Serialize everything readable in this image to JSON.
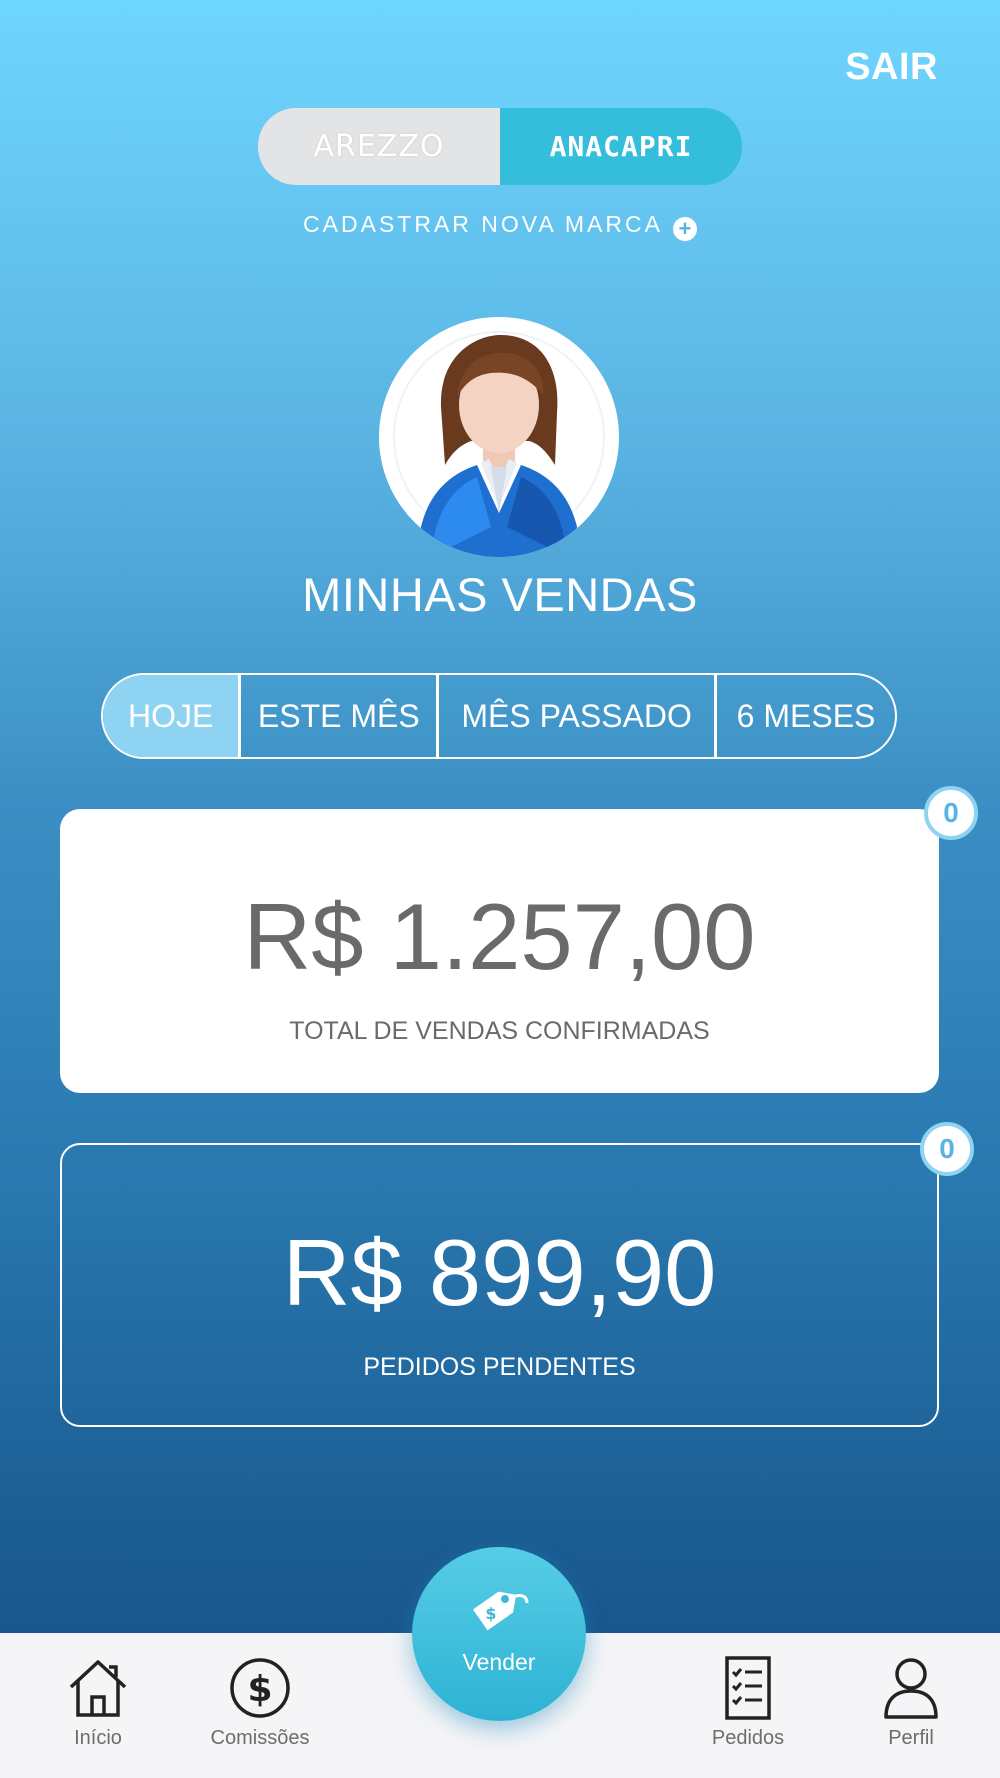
{
  "header": {
    "logout_label": "SAIR"
  },
  "brands": {
    "options": [
      {
        "label": "AREZZO",
        "active": false
      },
      {
        "label": "ANACAPRI",
        "active": true
      }
    ],
    "add_brand_label": "CADASTRAR NOVA MARCA",
    "add_brand_icon": "plus-circle-icon"
  },
  "profile": {
    "avatar_icon": "businesswoman-avatar"
  },
  "main": {
    "title": "MINHAS VENDAS",
    "period_tabs": [
      {
        "label": "HOJE",
        "selected": true
      },
      {
        "label": "ESTE MÊS",
        "selected": false
      },
      {
        "label": "MÊS PASSADO",
        "selected": false
      },
      {
        "label": "6 MESES",
        "selected": false
      }
    ],
    "confirmed": {
      "amount": "R$ 1.257,00",
      "label": "TOTAL DE VENDAS CONFIRMADAS",
      "badge": "0"
    },
    "pending": {
      "amount": "R$ 899,90",
      "label": "PEDIDOS PENDENTES",
      "badge": "0"
    }
  },
  "bottom_nav": {
    "items": [
      {
        "label": "Início",
        "icon": "home-icon"
      },
      {
        "label": "Comissões",
        "icon": "dollar-circle-icon"
      },
      {
        "label": "Vender",
        "icon": "price-tag-icon"
      },
      {
        "label": "Pedidos",
        "icon": "checklist-icon"
      },
      {
        "label": "Perfil",
        "icon": "user-icon"
      }
    ]
  },
  "colors": {
    "accent": "#34bedb",
    "gradient_top": "#6fd6fe",
    "gradient_bottom": "#154c83",
    "selected_tab": "#8fd3f2"
  }
}
